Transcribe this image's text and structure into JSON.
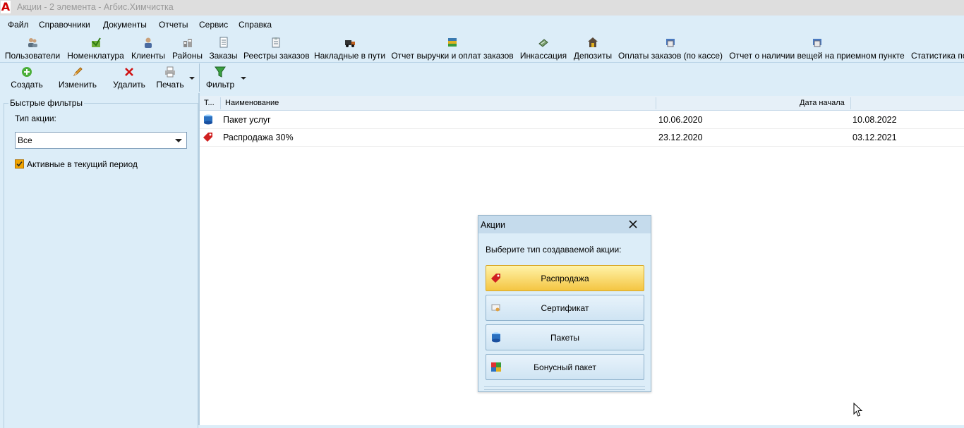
{
  "window": {
    "title": "Акции - 2 элемента - Агбис.Химчистка"
  },
  "menu": [
    "Файл",
    "Справочники",
    "Документы",
    "Отчеты",
    "Сервис",
    "Справка"
  ],
  "nav": [
    {
      "label": "Пользователи",
      "icon": "users-icon"
    },
    {
      "label": "Номенклатура",
      "icon": "nomenclature-icon"
    },
    {
      "label": "Клиенты",
      "icon": "client-icon"
    },
    {
      "label": "Районы",
      "icon": "districts-icon"
    },
    {
      "label": "Заказы",
      "icon": "orders-icon"
    },
    {
      "label": "Реестры заказов",
      "icon": "order-registry-icon"
    },
    {
      "label": "Накладные в пути",
      "icon": "truck-icon"
    },
    {
      "label": "Отчет выручки и оплат заказов",
      "icon": "revenue-report-icon"
    },
    {
      "label": "Инкассация",
      "icon": "cash-collection-icon"
    },
    {
      "label": "Депозиты",
      "icon": "deposits-icon"
    },
    {
      "label": "Оплаты заказов (по кассе)",
      "icon": "payments-icon"
    },
    {
      "label": "Отчет о наличии вещей на приемном пункте",
      "icon": "inventory-report-icon"
    },
    {
      "label": "Статистика по",
      "icon": "statistics-icon"
    }
  ],
  "actions": {
    "create": "Создать",
    "edit": "Изменить",
    "delete": "Удалить",
    "print": "Печать",
    "filter": "Фильтр"
  },
  "filters": {
    "legend": "Быстрые фильтры",
    "type_label": "Тип акции:",
    "type_value": "Все",
    "active_label": "Активные в текущий период",
    "active_checked": true
  },
  "grid": {
    "columns": [
      "Т...",
      "Наименование",
      "Дата начала"
    ],
    "rows": [
      {
        "type_icon": "package-icon",
        "name": "Пакет услуг",
        "start": "10.06.2020",
        "end": "10.08.2022"
      },
      {
        "type_icon": "sale-tag-icon",
        "name": "Распродажа 30%",
        "start": "23.12.2020",
        "end": "03.12.2021"
      }
    ]
  },
  "dialog": {
    "title": "Акции",
    "prompt": "Выберите тип создаваемой акции:",
    "options": [
      {
        "label": "Распродажа",
        "icon": "sale-tag-icon"
      },
      {
        "label": "Сертификат",
        "icon": "certificate-icon"
      },
      {
        "label": "Пакеты",
        "icon": "package-icon"
      },
      {
        "label": "Бонусный пакет",
        "icon": "bonus-package-icon"
      }
    ]
  },
  "colors": {
    "accent_red": "#d00000",
    "panel_bg": "#dcedf8",
    "highlight": "#f4c542"
  }
}
